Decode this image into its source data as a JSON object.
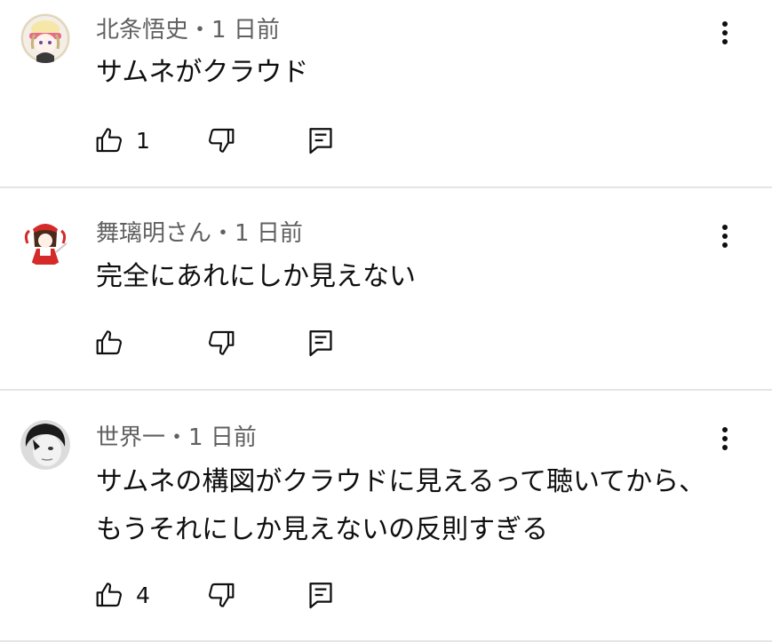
{
  "comments": [
    {
      "author": "北条悟史",
      "time": "・1 日前",
      "text_lines": [
        "サムネがクラウド"
      ],
      "likes": "1"
    },
    {
      "author": "舞璃明さん",
      "time": "・1 日前",
      "text_lines": [
        "完全にあれにしか見えない"
      ],
      "likes": ""
    },
    {
      "author": "世界一",
      "time": "・1 日前",
      "text_lines": [
        "サムネの構図がクラウドに見えるって聴いてから、",
        "もうそれにしか見えないの反則すぎる"
      ],
      "likes": "4"
    }
  ],
  "icons": {
    "like": "thumbs-up-icon",
    "dislike": "thumbs-down-icon",
    "reply": "reply-comment-icon",
    "more": "more-vertical-icon"
  },
  "colors": {
    "meta": "#606060",
    "text": "#0f0f0f",
    "divider": "#e5e5e5"
  }
}
